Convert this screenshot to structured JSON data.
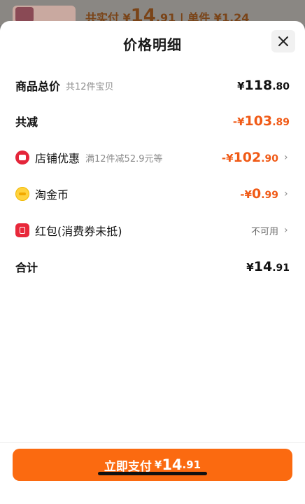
{
  "background": {
    "text_prefix": "共实付 ¥",
    "text_big": "14",
    "text_suffix": ".91 | 单件 ¥1.24"
  },
  "sheet": {
    "title": "价格明细",
    "close_icon": "close-icon"
  },
  "rows": {
    "total": {
      "label": "商品总价",
      "sub": "共12件宝贝",
      "sym": "¥",
      "int": "118",
      "dec": ".80"
    },
    "reduce": {
      "label": "共减",
      "sym": "-¥",
      "int": "103",
      "dec": ".89"
    },
    "shop": {
      "label": "店铺优惠",
      "sub": "满12件减52.9元等",
      "sym": "-¥",
      "int": "102",
      "dec": ".90",
      "icon": "shop-coupon-icon"
    },
    "coin": {
      "label": "淘金币",
      "sym": "-¥",
      "int": "0",
      "dec": ".99",
      "icon": "coin-icon"
    },
    "redpacket": {
      "label": "红包(消费券未抵)",
      "status": "不可用",
      "icon": "red-packet-icon"
    },
    "sum": {
      "label": "合计",
      "sym": "¥",
      "int": "14",
      "dec": ".91"
    }
  },
  "footer": {
    "pay_label": "立即支付",
    "sym": "¥",
    "int": "14",
    "dec": ".91"
  },
  "colors": {
    "accent": "#fb6a10",
    "discount": "#f05a16"
  }
}
